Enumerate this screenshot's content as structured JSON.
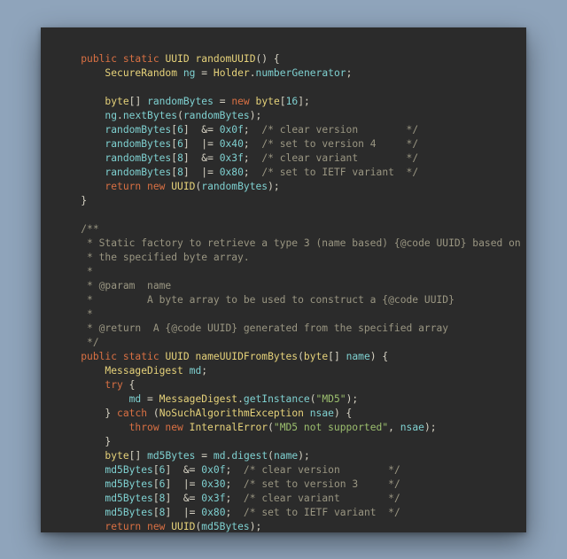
{
  "fn1": {
    "mods": "public static",
    "ret": "UUID",
    "name": "randomUUID",
    "l1_t": "SecureRandom",
    "l1_v": "ng",
    "l1_e": "Holder",
    "l1_f": "numberGenerator",
    "l2_t": "byte",
    "l2_v": "randomBytes",
    "l2_k": "new",
    "l2_t2": "byte",
    "l2_n": "16",
    "l3_v": "ng",
    "l3_m": "nextBytes",
    "l3_a": "randomBytes",
    "m": [
      {
        "v": "randomBytes",
        "i": "6",
        "op": "&=",
        "x": "0x0f",
        "c": "/* clear version        */"
      },
      {
        "v": "randomBytes",
        "i": "6",
        "op": "|=",
        "x": "0x40",
        "c": "/* set to version 4     */"
      },
      {
        "v": "randomBytes",
        "i": "8",
        "op": "&=",
        "x": "0x3f",
        "c": "/* clear variant        */"
      },
      {
        "v": "randomBytes",
        "i": "8",
        "op": "|=",
        "x": "0x80",
        "c": "/* set to IETF variant  */"
      }
    ],
    "ret_k": "return new",
    "ret_t": "UUID",
    "ret_a": "randomBytes"
  },
  "jd": {
    "l0": "/**",
    "l1": " * Static factory to retrieve a type 3 (name based) {@code UUID} based on",
    "l2": " * the specified byte array.",
    "l3": " *",
    "l4": " * @param  name",
    "l5": " *         A byte array to be used to construct a {@code UUID}",
    "l6": " *",
    "l7": " * @return  A {@code UUID} generated from the specified array",
    "l8": " */"
  },
  "fn2": {
    "mods": "public static",
    "ret": "UUID",
    "name": "nameUUIDFromBytes",
    "pt": "byte",
    "pn": "name",
    "l1_t": "MessageDigest",
    "l1_v": "md",
    "try_k": "try",
    "l2_v": "md",
    "l2_t": "MessageDigest",
    "l2_m": "getInstance",
    "l2_s": "\"MD5\"",
    "catch_k": "catch",
    "catch_t": "NoSuchAlgorithmException",
    "catch_v": "nsae",
    "throw_k": "throw new",
    "throw_t": "InternalError",
    "throw_s": "\"MD5 not supported\"",
    "throw_a": "nsae",
    "l3_t": "byte",
    "l3_v": "md5Bytes",
    "l3_r": "md",
    "l3_m": "digest",
    "l3_a": "name",
    "m": [
      {
        "v": "md5Bytes",
        "i": "6",
        "op": "&=",
        "x": "0x0f",
        "c": "/* clear version        */"
      },
      {
        "v": "md5Bytes",
        "i": "6",
        "op": "|=",
        "x": "0x30",
        "c": "/* set to version 3     */"
      },
      {
        "v": "md5Bytes",
        "i": "8",
        "op": "&=",
        "x": "0x3f",
        "c": "/* clear variant        */"
      },
      {
        "v": "md5Bytes",
        "i": "8",
        "op": "|=",
        "x": "0x80",
        "c": "/* set to IETF variant  */"
      }
    ],
    "ret_k": "return new",
    "ret_t": "UUID",
    "ret_a": "md5Bytes"
  }
}
